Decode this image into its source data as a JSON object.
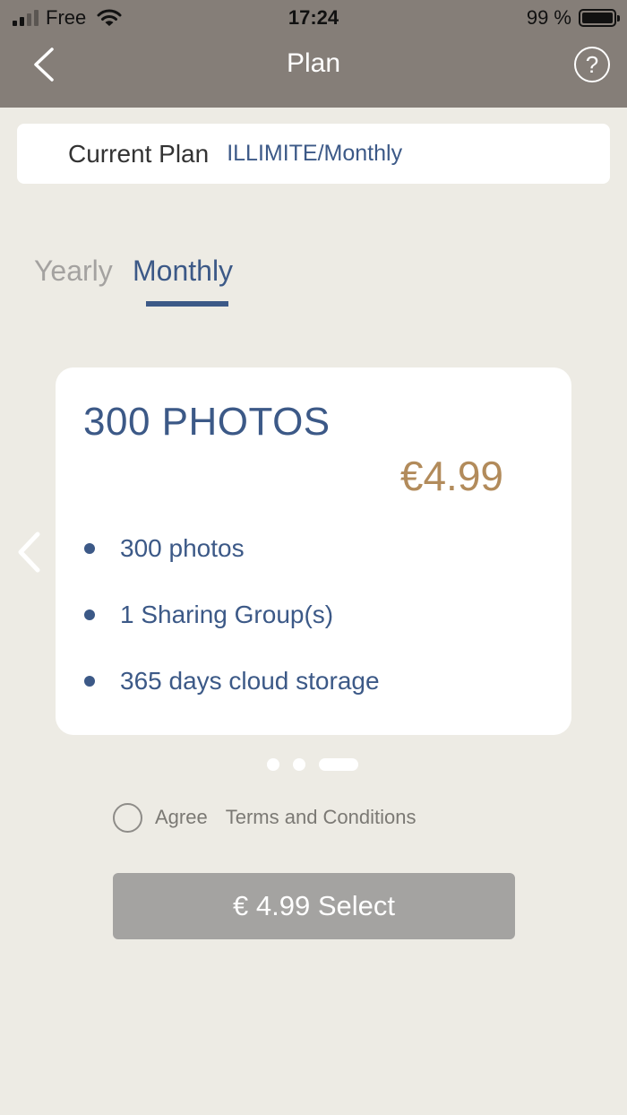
{
  "status_bar": {
    "carrier": "Free",
    "time": "17:24",
    "battery": "99 %",
    "battery_level": 0.99
  },
  "navbar": {
    "title": "Plan",
    "back_icon": "chevron-left-icon",
    "help_icon": "question-circle-icon",
    "help_glyph": "?"
  },
  "current_plan": {
    "label": "Current Plan",
    "value": "ILLIMITE/Monthly"
  },
  "tabs": [
    {
      "label": "Yearly",
      "active": false
    },
    {
      "label": "Monthly",
      "active": true
    }
  ],
  "plan": {
    "title": "300 PHOTOS",
    "price": "€4.99",
    "features": [
      "300 photos",
      "1 Sharing Group(s)",
      "365 days cloud storage"
    ]
  },
  "pager": {
    "count": 3,
    "active_index": 2
  },
  "agree": {
    "label": "Agree",
    "terms": "Terms and Conditions",
    "checked": false
  },
  "select_button": {
    "label": "€ 4.99 Select"
  },
  "colors": {
    "header": "#857e78",
    "background": "#edebe4",
    "accent_blue": "#3c5987",
    "price_gold": "#b28b5b",
    "button_disabled": "#a4a3a1"
  }
}
